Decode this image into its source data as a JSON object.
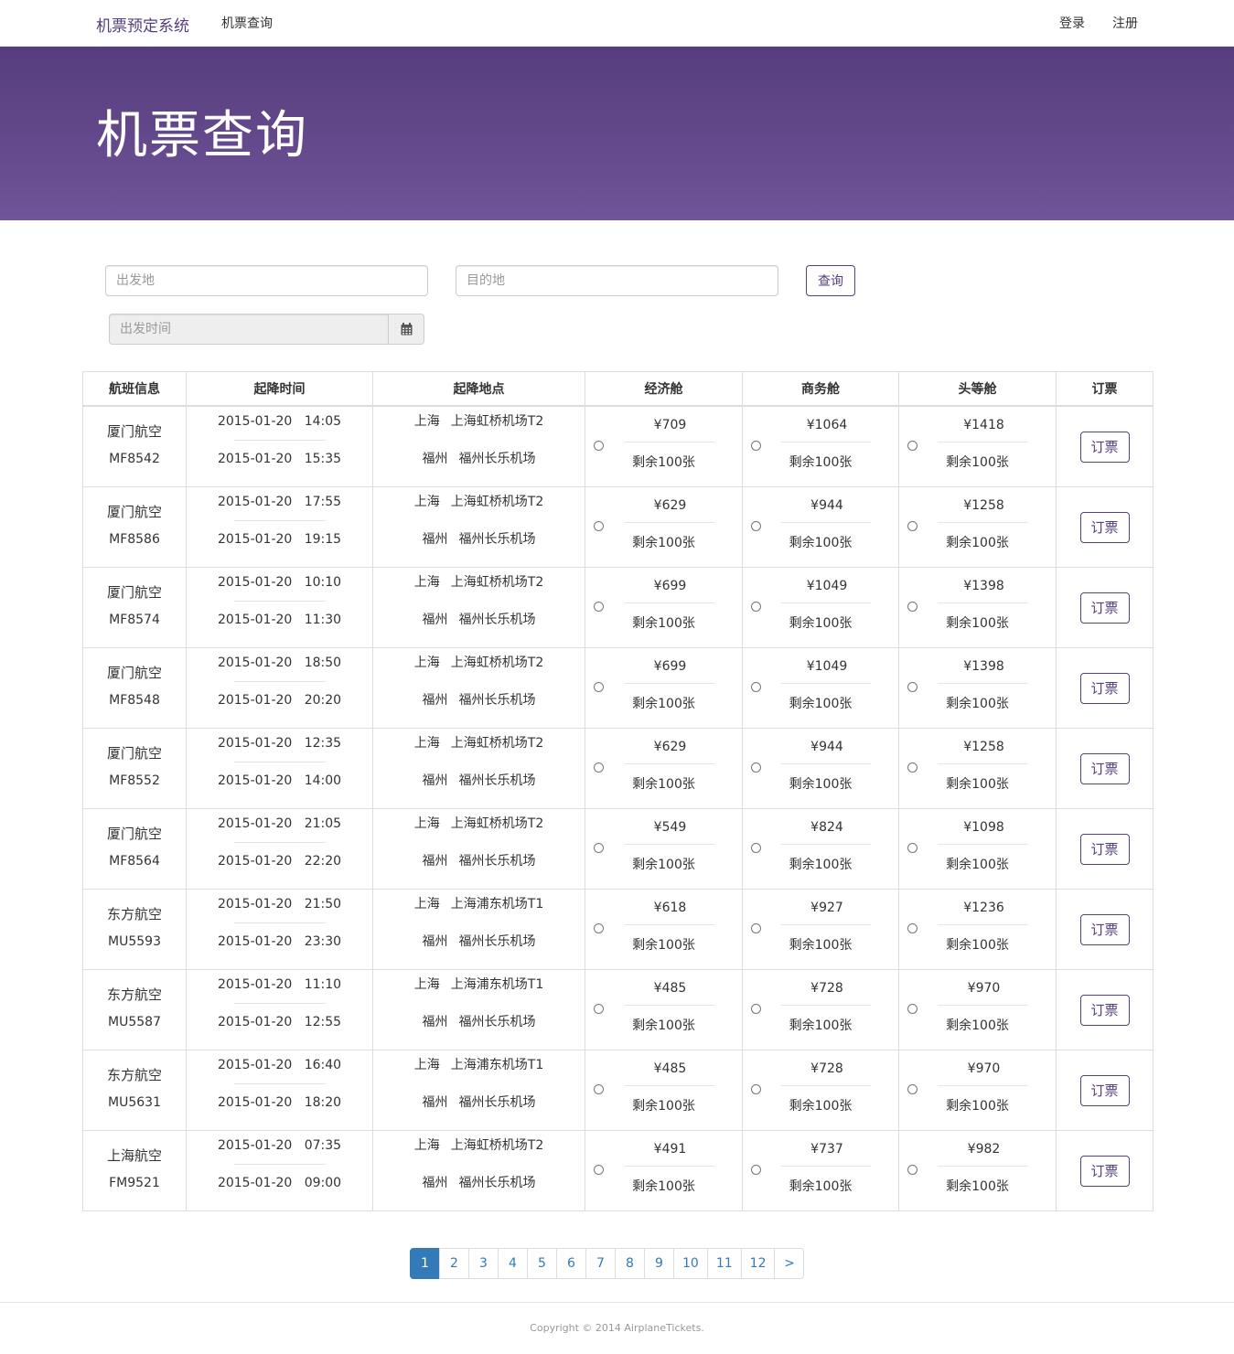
{
  "navbar": {
    "brand": "机票预定系统",
    "query_link": "机票查询",
    "login": "登录",
    "register": "注册"
  },
  "hero": {
    "title": "机票查询"
  },
  "search": {
    "origin_placeholder": "出发地",
    "destination_placeholder": "目的地",
    "query_button": "查询",
    "date_placeholder": "出发时间"
  },
  "table": {
    "headers": [
      "航班信息",
      "起降时间",
      "起降地点",
      "经济舱",
      "商务舱",
      "头等舱",
      "订票"
    ],
    "book_label": "订票",
    "rows": [
      {
        "airline": "厦门航空",
        "flight": "MF8542",
        "dep_date": "2015-01-20",
        "dep_time": "14:05",
        "arr_date": "2015-01-20",
        "arr_time": "15:35",
        "from_city": "上海",
        "from_airport": "上海虹桥机场T2",
        "to_city": "福州",
        "to_airport": "福州长乐机场",
        "economy": "¥709",
        "business": "¥1064",
        "first": "¥1418",
        "remain": "剩余100张"
      },
      {
        "airline": "厦门航空",
        "flight": "MF8586",
        "dep_date": "2015-01-20",
        "dep_time": "17:55",
        "arr_date": "2015-01-20",
        "arr_time": "19:15",
        "from_city": "上海",
        "from_airport": "上海虹桥机场T2",
        "to_city": "福州",
        "to_airport": "福州长乐机场",
        "economy": "¥629",
        "business": "¥944",
        "first": "¥1258",
        "remain": "剩余100张"
      },
      {
        "airline": "厦门航空",
        "flight": "MF8574",
        "dep_date": "2015-01-20",
        "dep_time": "10:10",
        "arr_date": "2015-01-20",
        "arr_time": "11:30",
        "from_city": "上海",
        "from_airport": "上海虹桥机场T2",
        "to_city": "福州",
        "to_airport": "福州长乐机场",
        "economy": "¥699",
        "business": "¥1049",
        "first": "¥1398",
        "remain": "剩余100张"
      },
      {
        "airline": "厦门航空",
        "flight": "MF8548",
        "dep_date": "2015-01-20",
        "dep_time": "18:50",
        "arr_date": "2015-01-20",
        "arr_time": "20:20",
        "from_city": "上海",
        "from_airport": "上海虹桥机场T2",
        "to_city": "福州",
        "to_airport": "福州长乐机场",
        "economy": "¥699",
        "business": "¥1049",
        "first": "¥1398",
        "remain": "剩余100张"
      },
      {
        "airline": "厦门航空",
        "flight": "MF8552",
        "dep_date": "2015-01-20",
        "dep_time": "12:35",
        "arr_date": "2015-01-20",
        "arr_time": "14:00",
        "from_city": "上海",
        "from_airport": "上海虹桥机场T2",
        "to_city": "福州",
        "to_airport": "福州长乐机场",
        "economy": "¥629",
        "business": "¥944",
        "first": "¥1258",
        "remain": "剩余100张"
      },
      {
        "airline": "厦门航空",
        "flight": "MF8564",
        "dep_date": "2015-01-20",
        "dep_time": "21:05",
        "arr_date": "2015-01-20",
        "arr_time": "22:20",
        "from_city": "上海",
        "from_airport": "上海虹桥机场T2",
        "to_city": "福州",
        "to_airport": "福州长乐机场",
        "economy": "¥549",
        "business": "¥824",
        "first": "¥1098",
        "remain": "剩余100张"
      },
      {
        "airline": "东方航空",
        "flight": "MU5593",
        "dep_date": "2015-01-20",
        "dep_time": "21:50",
        "arr_date": "2015-01-20",
        "arr_time": "23:30",
        "from_city": "上海",
        "from_airport": "上海浦东机场T1",
        "to_city": "福州",
        "to_airport": "福州长乐机场",
        "economy": "¥618",
        "business": "¥927",
        "first": "¥1236",
        "remain": "剩余100张"
      },
      {
        "airline": "东方航空",
        "flight": "MU5587",
        "dep_date": "2015-01-20",
        "dep_time": "11:10",
        "arr_date": "2015-01-20",
        "arr_time": "12:55",
        "from_city": "上海",
        "from_airport": "上海浦东机场T1",
        "to_city": "福州",
        "to_airport": "福州长乐机场",
        "economy": "¥485",
        "business": "¥728",
        "first": "¥970",
        "remain": "剩余100张"
      },
      {
        "airline": "东方航空",
        "flight": "MU5631",
        "dep_date": "2015-01-20",
        "dep_time": "16:40",
        "arr_date": "2015-01-20",
        "arr_time": "18:20",
        "from_city": "上海",
        "from_airport": "上海浦东机场T1",
        "to_city": "福州",
        "to_airport": "福州长乐机场",
        "economy": "¥485",
        "business": "¥728",
        "first": "¥970",
        "remain": "剩余100张"
      },
      {
        "airline": "上海航空",
        "flight": "FM9521",
        "dep_date": "2015-01-20",
        "dep_time": "07:35",
        "arr_date": "2015-01-20",
        "arr_time": "09:00",
        "from_city": "上海",
        "from_airport": "上海虹桥机场T2",
        "to_city": "福州",
        "to_airport": "福州长乐机场",
        "economy": "¥491",
        "business": "¥737",
        "first": "¥982",
        "remain": "剩余100张"
      }
    ]
  },
  "pagination": {
    "pages": [
      "1",
      "2",
      "3",
      "4",
      "5",
      "6",
      "7",
      "8",
      "9",
      "10",
      "11",
      "12"
    ],
    "active": "1",
    "next": ">"
  },
  "footer": {
    "copyright": "Copyright © 2014 AirplaneTickets."
  },
  "colors": {
    "brand_purple": "#563d7c",
    "hero_bottom": "#6f5499",
    "link_blue": "#337ab7"
  },
  "icons": {
    "date_addon": "calendar-icon"
  }
}
